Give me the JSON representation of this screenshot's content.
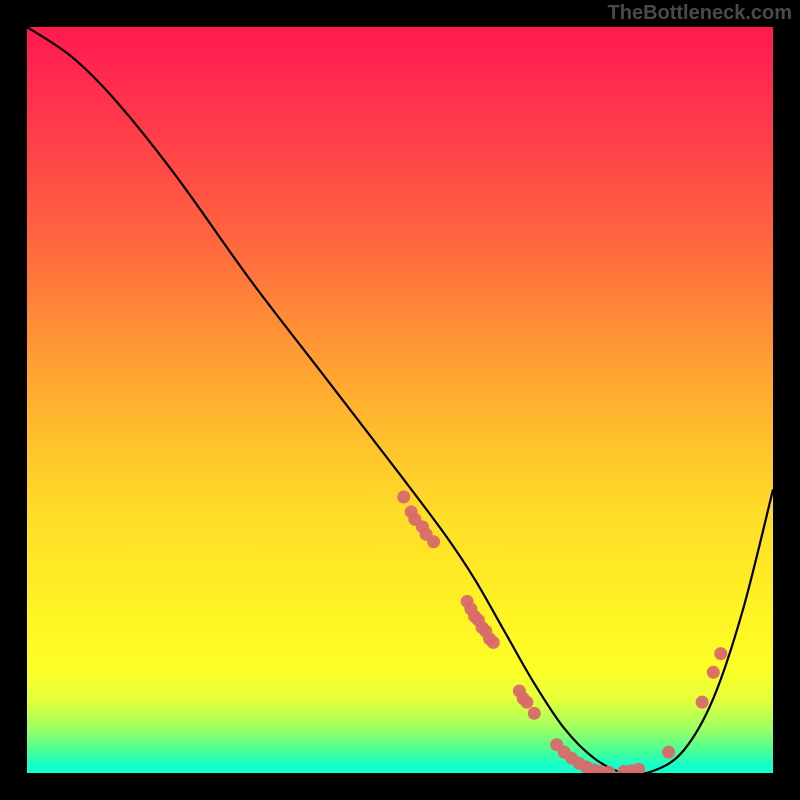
{
  "watermark": "TheBottleneck.com",
  "chart_data": {
    "type": "line",
    "title": "",
    "xlabel": "",
    "ylabel": "",
    "xlim": [
      0,
      100
    ],
    "ylim": [
      0,
      100
    ],
    "series": [
      {
        "name": "curve",
        "x": [
          0,
          6,
          12,
          20,
          30,
          40,
          50,
          56,
          60,
          64,
          68,
          72,
          76,
          80,
          84,
          88,
          92,
          96,
          100
        ],
        "y": [
          100,
          96,
          90,
          80,
          66,
          53,
          40,
          32,
          26,
          19,
          12,
          6,
          2,
          0,
          0.3,
          3,
          10,
          22,
          38
        ]
      }
    ],
    "points": [
      {
        "x": 50.5,
        "y": 37
      },
      {
        "x": 51.5,
        "y": 35
      },
      {
        "x": 52.0,
        "y": 34
      },
      {
        "x": 53.0,
        "y": 33
      },
      {
        "x": 53.5,
        "y": 32
      },
      {
        "x": 54.5,
        "y": 31
      },
      {
        "x": 59.0,
        "y": 23
      },
      {
        "x": 59.5,
        "y": 22
      },
      {
        "x": 60.0,
        "y": 21
      },
      {
        "x": 60.5,
        "y": 20.5
      },
      {
        "x": 61.0,
        "y": 19.5
      },
      {
        "x": 61.5,
        "y": 19
      },
      {
        "x": 62.0,
        "y": 18
      },
      {
        "x": 62.5,
        "y": 17.5
      },
      {
        "x": 66.0,
        "y": 11
      },
      {
        "x": 66.5,
        "y": 10
      },
      {
        "x": 67.0,
        "y": 9.5
      },
      {
        "x": 68.0,
        "y": 8
      },
      {
        "x": 71.0,
        "y": 3.8
      },
      {
        "x": 72.0,
        "y": 2.8
      },
      {
        "x": 73.0,
        "y": 2
      },
      {
        "x": 74.0,
        "y": 1.3
      },
      {
        "x": 75.0,
        "y": 0.8
      },
      {
        "x": 76.0,
        "y": 0.4
      },
      {
        "x": 77.0,
        "y": 0.2
      },
      {
        "x": 78.0,
        "y": 0.1
      },
      {
        "x": 80.0,
        "y": 0.2
      },
      {
        "x": 81.0,
        "y": 0.3
      },
      {
        "x": 82.0,
        "y": 0.5
      },
      {
        "x": 86.0,
        "y": 2.8
      },
      {
        "x": 90.5,
        "y": 9.5
      },
      {
        "x": 92.0,
        "y": 13.5
      },
      {
        "x": 93.0,
        "y": 16
      }
    ],
    "gradient_stops": [
      {
        "pos": 0,
        "color": "#ff1a4d"
      },
      {
        "pos": 50,
        "color": "#ffb62e"
      },
      {
        "pos": 85,
        "color": "#fcff26"
      },
      {
        "pos": 100,
        "color": "#14ffca"
      }
    ]
  }
}
